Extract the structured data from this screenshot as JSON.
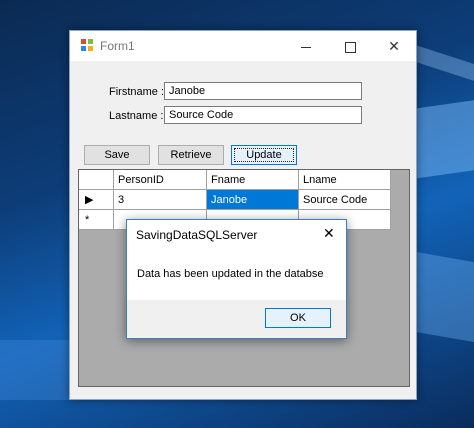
{
  "window": {
    "title": "Form1",
    "minimize_glyph": "",
    "close_glyph": "✕"
  },
  "form": {
    "firstname_label": "Firstname :",
    "firstname_value": "Janobe",
    "lastname_label": "Lastname :",
    "lastname_value": "Source Code"
  },
  "buttons": {
    "save": "Save",
    "retrieve": "Retrieve",
    "update": "Update"
  },
  "grid": {
    "columns": [
      "PersonID",
      "Fname",
      "Lname"
    ],
    "rows": [
      {
        "indicator": "▶",
        "PersonID": "3",
        "Fname": "Janobe",
        "Lname": "Source Code"
      },
      {
        "indicator": "*",
        "PersonID": "",
        "Fname": "",
        "Lname": ""
      }
    ]
  },
  "dialog": {
    "title": "SavingDataSQLServer",
    "message": "Data has been updated in the databse",
    "ok_label": "OK",
    "close_glyph": "✕"
  },
  "colors": {
    "accent": "#0078d7",
    "selection": "#0078d7",
    "window_bg": "#f0f0f0"
  }
}
